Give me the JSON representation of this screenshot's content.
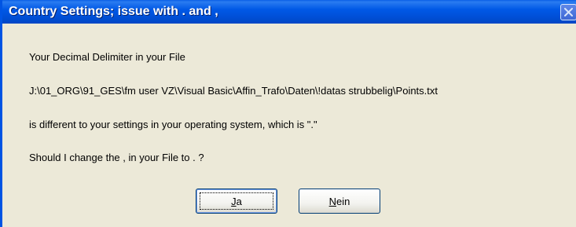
{
  "window": {
    "title": "Country Settings; issue with . and ,",
    "close_icon": "close-icon"
  },
  "message": {
    "line1": "Your Decimal Delimiter in your File",
    "line2": "J:\\01_ORG\\91_GES\\fm user VZ\\Visual Basic\\Affin_Trafo\\Daten\\!datas strubbelig\\Points.txt",
    "line3": "is different to your settings in your operating system, which is \".\"",
    "line4": "Should I change the , in your File to . ?"
  },
  "buttons": {
    "yes": {
      "accel": "J",
      "rest": "a"
    },
    "no": {
      "accel": "N",
      "rest": "ein"
    }
  },
  "colors": {
    "titlebar": "#0058e6",
    "window_bg": "#ece9d8",
    "button_border": "#003c74"
  }
}
